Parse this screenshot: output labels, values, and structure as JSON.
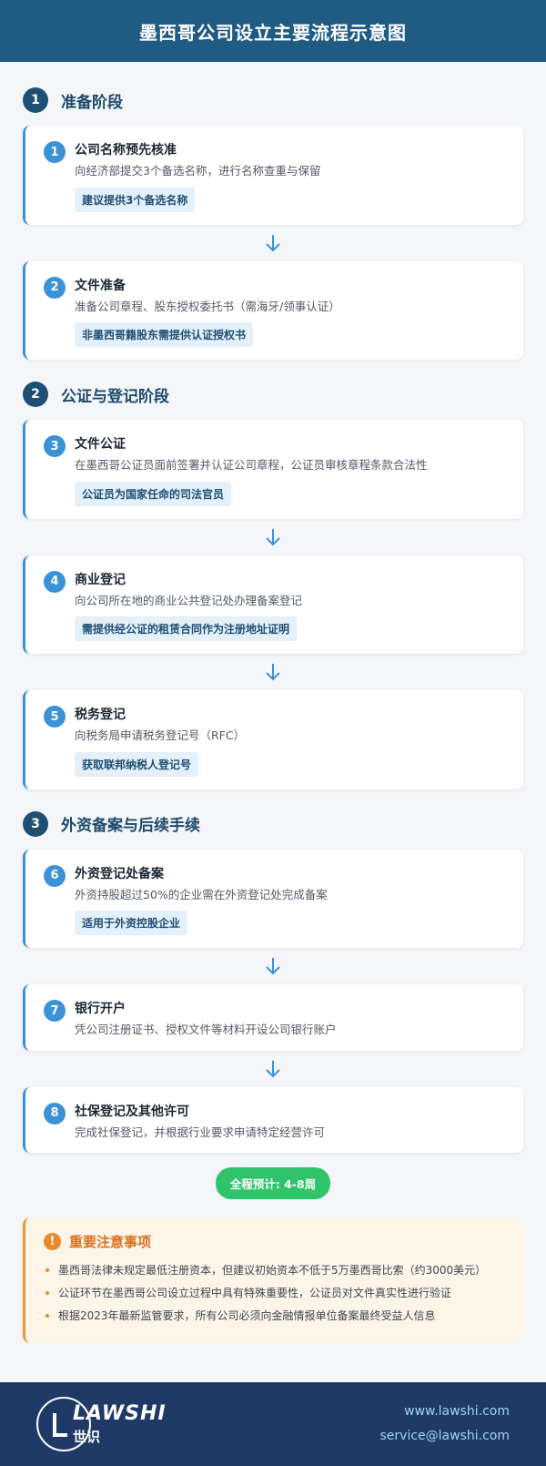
{
  "header": {
    "title": "墨西哥公司设立主要流程示意图"
  },
  "phases": [
    {
      "num": "1",
      "title": "准备阶段"
    },
    {
      "num": "2",
      "title": "公证与登记阶段"
    },
    {
      "num": "3",
      "title": "外资备案与后续手续"
    }
  ],
  "steps": [
    {
      "num": "1",
      "title": "公司名称预先核准",
      "desc": "向经济部提交3个备选名称，进行名称查重与保留",
      "tag": "建议提供3个备选名称"
    },
    {
      "num": "2",
      "title": "文件准备",
      "desc": "准备公司章程、股东授权委托书（需海牙/领事认证）",
      "tag": "非墨西哥籍股东需提供认证授权书"
    },
    {
      "num": "3",
      "title": "文件公证",
      "desc": "在墨西哥公证员面前签署并认证公司章程，公证员审核章程条款合法性",
      "tag": "公证员为国家任命的司法官员"
    },
    {
      "num": "4",
      "title": "商业登记",
      "desc": "向公司所在地的商业公共登记处办理备案登记",
      "tag": "需提供经公证的租赁合同作为注册地址证明"
    },
    {
      "num": "5",
      "title": "税务登记",
      "desc": "向税务局申请税务登记号（RFC）",
      "tag": "获取联邦纳税人登记号"
    },
    {
      "num": "6",
      "title": "外资登记处备案",
      "desc": "外资持股超过50%的企业需在外资登记处完成备案",
      "tag": "适用于外资控股企业"
    },
    {
      "num": "7",
      "title": "银行开户",
      "desc": "凭公司注册证书、授权文件等材料开设公司银行账户"
    },
    {
      "num": "8",
      "title": "社保登记及其他许可",
      "desc": "完成社保登记，并根据行业要求申请特定经营许可"
    }
  ],
  "duration": "全程预计: 4-8周",
  "notes": {
    "icon": "!",
    "title": "重要注意事项",
    "items": [
      "墨西哥法律未规定最低注册资本，但建议初始资本不低于5万墨西哥比索（约3000美元）",
      "公证环节在墨西哥公司设立过程中具有特殊重要性，公证员对文件真实性进行验证",
      "根据2023年最新监管要求，所有公司必须向金融情报单位备案最终受益人信息"
    ]
  },
  "footer": {
    "logo_word": "LAWSHI",
    "logo_cn": "世识",
    "website": "www.lawshi.com",
    "email": "service@lawshi.com"
  },
  "colors": {
    "header_bg": "#1f5b82",
    "phase_badge": "#1f4f72",
    "step_badge": "#3c92d6",
    "tag_bg": "#e4f0fa",
    "duration_bg": "#2fc46b",
    "notes_accent": "#e8892a",
    "footer_bg": "#1f3a66"
  }
}
